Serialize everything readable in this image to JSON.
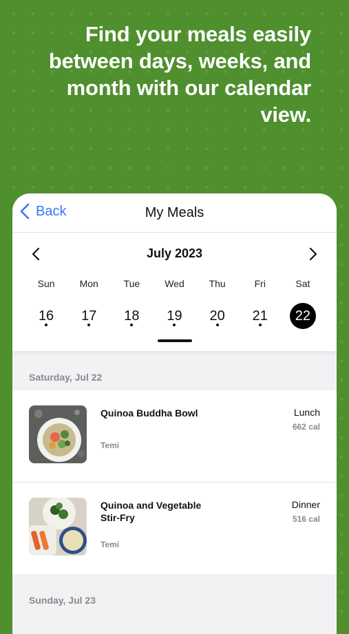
{
  "headline": "Find your meals easily between days, weeks, and month with our calendar view.",
  "nav": {
    "back_label": "Back",
    "title": "My Meals"
  },
  "calendar": {
    "month": "July 2023",
    "day_names": [
      "Sun",
      "Mon",
      "Tue",
      "Wed",
      "Thu",
      "Fri",
      "Sat"
    ],
    "dates": [
      "16",
      "17",
      "18",
      "19",
      "20",
      "21",
      "22"
    ],
    "selected_date": "22"
  },
  "sections": [
    {
      "header": "Saturday, Jul 22",
      "meals": [
        {
          "name": "Quinoa Buddha Bowl",
          "author": "Temi",
          "type": "Lunch",
          "calories": "662 cal"
        },
        {
          "name": "Quinoa and Vegetable Stir-Fry",
          "author": "Temi",
          "type": "Dinner",
          "calories": "516 cal"
        }
      ]
    },
    {
      "header": "Sunday, Jul 23",
      "meals": []
    }
  ],
  "colors": {
    "background": "#4f8f2e",
    "accent": "#3478f6",
    "selected": "#000000"
  },
  "icons": [
    "chevron-left-icon",
    "chevron-right-icon"
  ]
}
